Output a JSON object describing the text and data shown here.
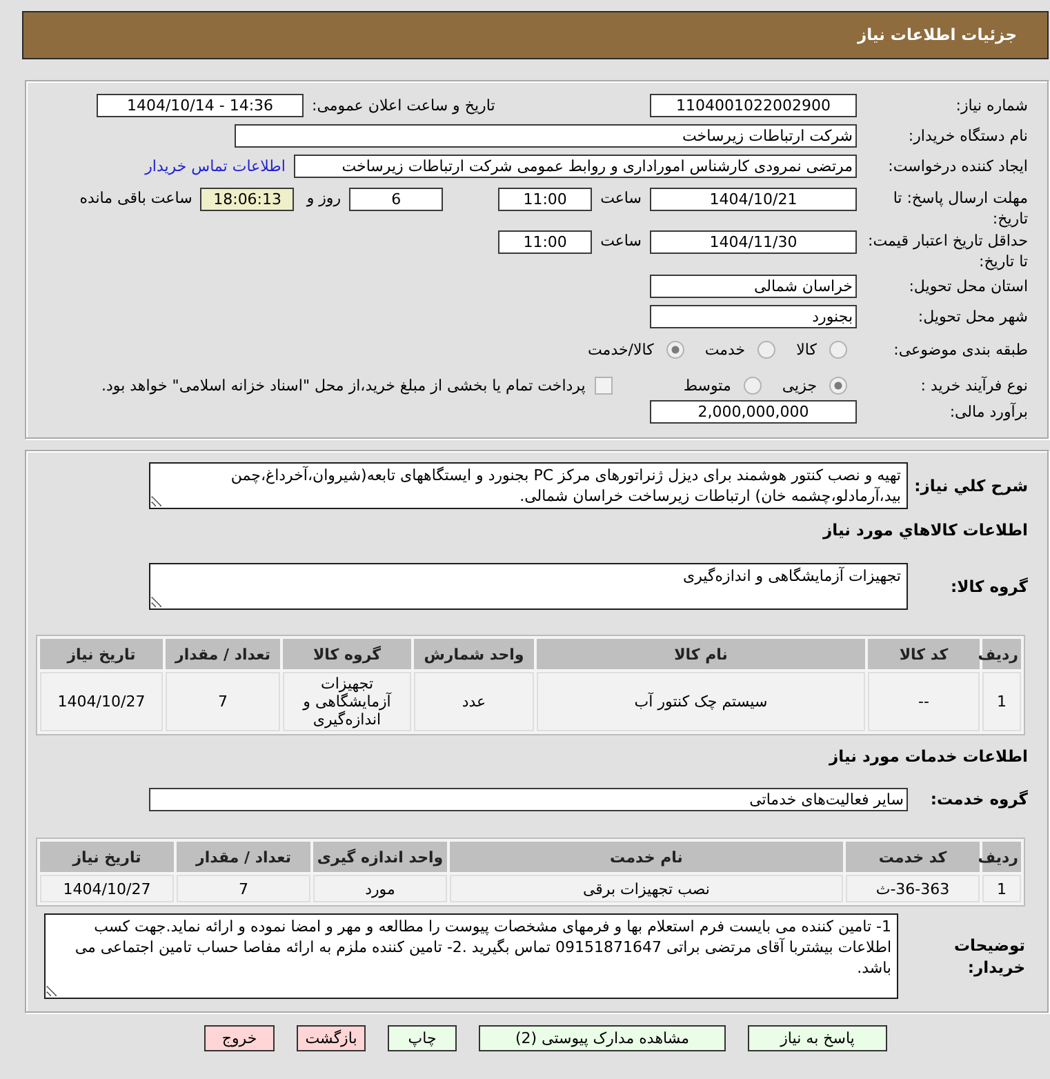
{
  "header": {
    "title": "جزئیات اطلاعات نیاز"
  },
  "general": {
    "need_number": {
      "label": "شماره نیاز:",
      "value": "1104001022002900"
    },
    "announce_datetime": {
      "label": "تاریخ و ساعت اعلان عمومی:",
      "value": "1404/10/14 - 14:36"
    },
    "buyer_org": {
      "label": "نام دستگاه خریدار:",
      "value": "شرکت ارتباطات زیرساخت"
    },
    "requester": {
      "label": "ایجاد کننده درخواست:",
      "value": "مرتضی نمرودی کارشناس اموراداری و روابط عمومی شرکت ارتباطات زیرساخت",
      "link": "اطلاعات تماس خریدار"
    },
    "reply_deadline": {
      "label": "مهلت ارسال پاسخ: تا تاریخ:",
      "date": "1404/10/21",
      "time_label": "ساعت",
      "time": "11:00",
      "days": "6",
      "days_label": "روز و",
      "remaining": "18:06:13",
      "remaining_label": "ساعت باقی مانده"
    },
    "price_validity": {
      "label": "حداقل تاریخ اعتبار قیمت: تا تاریخ:",
      "date": "1404/11/30",
      "time_label": "ساعت",
      "time": "11:00"
    },
    "province": {
      "label": "استان محل تحویل:",
      "value": "خراسان شمالی"
    },
    "city": {
      "label": "شهر محل تحویل:",
      "value": "بجنورد"
    },
    "category": {
      "label": "طبقه بندی موضوعی:",
      "options": [
        {
          "label": "کالا",
          "selected": false
        },
        {
          "label": "خدمت",
          "selected": false
        },
        {
          "label": "کالا/خدمت",
          "selected": true
        }
      ]
    },
    "process": {
      "label": "نوع فرآیند خرید :",
      "options": [
        {
          "label": "جزیی",
          "selected": true
        },
        {
          "label": "متوسط",
          "selected": false
        }
      ],
      "treasury": {
        "label": "پرداخت تمام یا بخشی از مبلغ خرید،از محل \"اسناد خزانه اسلامی\" خواهد بود.",
        "checked": false
      }
    },
    "budget": {
      "label": "برآورد مالی:",
      "value": "2,000,000,000"
    }
  },
  "description": {
    "label": "شرح کلي نياز:",
    "value": "تهیه و نصب کنتور هوشمند برای دیزل ژنراتورهای مرکز PC بجنورد و ایستگاههای تابعه(شیروان،آخرداغ،چمن بید،آرمادلو،چشمه خان) ارتباطات زیرساخت خراسان شمالی."
  },
  "goods": {
    "heading": "اطلاعات کالاهاي مورد نياز",
    "group_label": "گروه کالا:",
    "group": "تجهیزات آزمایشگاهی و اندازه‌گیری",
    "table": {
      "columns": [
        "ردیف",
        "کد کالا",
        "نام کالا",
        "واحد شمارش",
        "گروه کالا",
        "تعداد / مقدار",
        "تاریخ نیاز"
      ],
      "rows": [
        [
          "1",
          "--",
          "سیستم چک کنتور آب",
          "عدد",
          "تجهیزات آزمایشگاهی و اندازه‌گیری",
          "7",
          "1404/10/27"
        ]
      ]
    }
  },
  "services": {
    "heading": "اطلاعات خدمات مورد نیاز",
    "group_label": "گروه خدمت:",
    "group": "سایر فعالیت‌های خدماتی",
    "table": {
      "columns": [
        "ردیف",
        "کد خدمت",
        "نام خدمت",
        "واحد اندازه گیری",
        "تعداد / مقدار",
        "تاریخ نیاز"
      ],
      "rows": [
        [
          "1",
          "36-363-ث",
          "نصب تجهیزات برقی",
          "مورد",
          "7",
          "1404/10/27"
        ]
      ]
    }
  },
  "buyer_notes": {
    "label": "توضیحات خریدار:",
    "value": "1- تامین کننده می بایست فرم استعلام بها و فرمهای مشخصات پیوست را مطالعه و مهر و امضا نموده و ارائه نماید.جهت کسب اطلاعات بیشتربا آقای مرتضی براتی 09151871647 تماس بگیرید .2- تامین کننده ملزم به ارائه مفاصا حساب تامین اجتماعی می باشد."
  },
  "buttons": [
    {
      "label": "پاسخ به نیاز",
      "kind": "reply"
    },
    {
      "label": "مشاهده مدارک پیوستی (2)",
      "kind": "attachments"
    },
    {
      "label": "چاپ",
      "kind": "print"
    },
    {
      "label": "بازگشت",
      "kind": "back"
    },
    {
      "label": "خروج",
      "kind": "exit"
    }
  ]
}
